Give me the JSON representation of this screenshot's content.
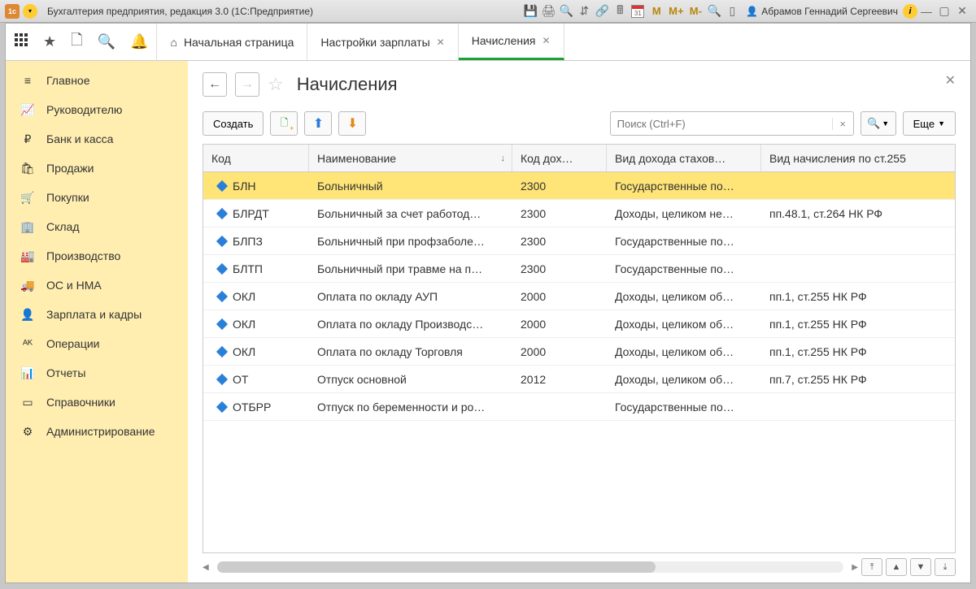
{
  "titlebar": {
    "app_title": "Бухгалтерия предприятия, редакция 3.0  (1С:Предприятие)",
    "m_buttons": [
      "M",
      "M+",
      "M-"
    ],
    "user_name": "Абрамов Геннадий Сергеевич"
  },
  "tabs": {
    "home": "Начальная страница",
    "items": [
      {
        "label": "Настройки зарплаты",
        "active": false
      },
      {
        "label": "Начисления",
        "active": true
      }
    ]
  },
  "sidebar": {
    "items": [
      {
        "icon": "≡",
        "label": "Главное"
      },
      {
        "icon": "📈",
        "label": "Руководителю"
      },
      {
        "icon": "₽",
        "label": "Банк и касса"
      },
      {
        "icon": "🛍",
        "label": "Продажи"
      },
      {
        "icon": "🛒",
        "label": "Покупки"
      },
      {
        "icon": "🏢",
        "label": "Склад"
      },
      {
        "icon": "🏭",
        "label": "Производство"
      },
      {
        "icon": "🚚",
        "label": "ОС и НМА"
      },
      {
        "icon": "👤",
        "label": "Зарплата и кадры"
      },
      {
        "icon": "ᴬᴷ",
        "label": "Операции"
      },
      {
        "icon": "📊",
        "label": "Отчеты"
      },
      {
        "icon": "▭",
        "label": "Справочники"
      },
      {
        "icon": "⚙",
        "label": "Администрирование"
      }
    ]
  },
  "page": {
    "title": "Начисления",
    "create_label": "Создать",
    "search_placeholder": "Поиск (Ctrl+F)",
    "more_label": "Еще"
  },
  "table": {
    "columns": [
      "Код",
      "Наименование",
      "Код дох…",
      "Вид дохода стахов…",
      "Вид начисления по ст.255"
    ],
    "sort_col": 1,
    "rows": [
      {
        "code": "БЛН",
        "name": "Больничный",
        "income_code": "2300",
        "income_type": "Государственные по…",
        "charge_type": "",
        "selected": true
      },
      {
        "code": "БЛРДТ",
        "name": "Больничный за счет работод…",
        "income_code": "2300",
        "income_type": "Доходы, целиком не…",
        "charge_type": "пп.48.1, ст.264 НК РФ"
      },
      {
        "code": "БЛПЗ",
        "name": "Больничный при профзаболе…",
        "income_code": "2300",
        "income_type": "Государственные по…",
        "charge_type": ""
      },
      {
        "code": "БЛТП",
        "name": "Больничный при травме на п…",
        "income_code": "2300",
        "income_type": "Государственные по…",
        "charge_type": ""
      },
      {
        "code": "ОКЛ",
        "name": "Оплата по окладу АУП",
        "income_code": "2000",
        "income_type": "Доходы, целиком об…",
        "charge_type": "пп.1, ст.255 НК РФ"
      },
      {
        "code": "ОКЛ",
        "name": "Оплата по окладу Производс…",
        "income_code": "2000",
        "income_type": "Доходы, целиком об…",
        "charge_type": "пп.1, ст.255 НК РФ"
      },
      {
        "code": "ОКЛ",
        "name": "Оплата по окладу Торговля",
        "income_code": "2000",
        "income_type": "Доходы, целиком об…",
        "charge_type": "пп.1, ст.255 НК РФ"
      },
      {
        "code": "ОТ",
        "name": "Отпуск основной",
        "income_code": "2012",
        "income_type": "Доходы, целиком об…",
        "charge_type": "пп.7, ст.255 НК РФ"
      },
      {
        "code": "ОТБРР",
        "name": "Отпуск по беременности и ро…",
        "income_code": "",
        "income_type": "Государственные по…",
        "charge_type": ""
      }
    ]
  }
}
